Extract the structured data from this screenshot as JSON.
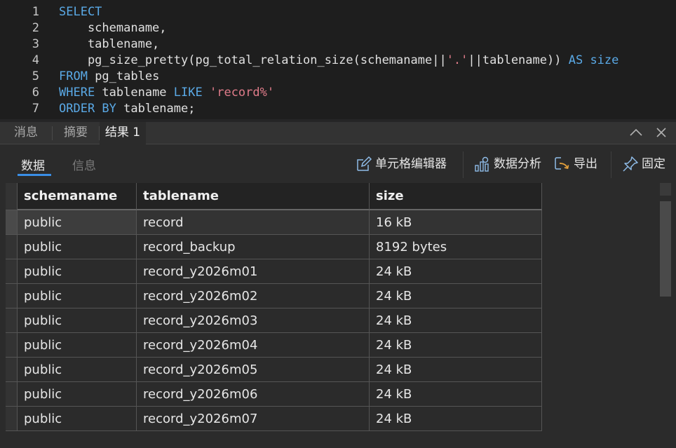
{
  "editor": {
    "lines": [
      {
        "n": "1",
        "tokens": [
          {
            "t": "SELECT",
            "k": "kw"
          }
        ]
      },
      {
        "n": "2",
        "tokens": [
          {
            "t": "    schemaname,",
            "k": "id"
          }
        ]
      },
      {
        "n": "3",
        "tokens": [
          {
            "t": "    tablename,",
            "k": "id"
          }
        ]
      },
      {
        "n": "4",
        "tokens": [
          {
            "t": "    pg_size_pretty(pg_total_relation_size(schemaname||",
            "k": "id"
          },
          {
            "t": "'.'",
            "k": "str"
          },
          {
            "t": "||tablename)) ",
            "k": "id"
          },
          {
            "t": "AS",
            "k": "kw"
          },
          {
            "t": " ",
            "k": "id"
          },
          {
            "t": "size",
            "k": "kw"
          }
        ]
      },
      {
        "n": "5",
        "tokens": [
          {
            "t": "FROM",
            "k": "kw"
          },
          {
            "t": " pg_tables",
            "k": "id"
          }
        ]
      },
      {
        "n": "6",
        "tokens": [
          {
            "t": "WHERE",
            "k": "kw"
          },
          {
            "t": " tablename ",
            "k": "id"
          },
          {
            "t": "LIKE",
            "k": "kw"
          },
          {
            "t": " ",
            "k": "id"
          },
          {
            "t": "'record%'",
            "k": "str"
          }
        ]
      },
      {
        "n": "7",
        "tokens": [
          {
            "t": "ORDER BY",
            "k": "kw"
          },
          {
            "t": " tablename;",
            "k": "id"
          }
        ]
      }
    ]
  },
  "panel_tabs": [
    {
      "label": "消息",
      "active": false
    },
    {
      "label": "摘要",
      "active": false
    },
    {
      "label": "结果 1",
      "active": true
    }
  ],
  "subtabs": {
    "data": "数据",
    "info": "信息"
  },
  "toolbar": {
    "cell_editor": "单元格编辑器",
    "analysis": "数据分析",
    "export": "导出",
    "pin": "固定"
  },
  "grid": {
    "columns": [
      "schemaname",
      "tablename",
      "size"
    ],
    "rows": [
      [
        "public",
        "record",
        "16 kB"
      ],
      [
        "public",
        "record_backup",
        "8192 bytes"
      ],
      [
        "public",
        "record_y2026m01",
        "24 kB"
      ],
      [
        "public",
        "record_y2026m02",
        "24 kB"
      ],
      [
        "public",
        "record_y2026m03",
        "24 kB"
      ],
      [
        "public",
        "record_y2026m04",
        "24 kB"
      ],
      [
        "public",
        "record_y2026m05",
        "24 kB"
      ],
      [
        "public",
        "record_y2026m06",
        "24 kB"
      ],
      [
        "public",
        "record_y2026m07",
        "24 kB"
      ]
    ],
    "selected_row": 0
  },
  "colors": {
    "keyword": "#5aa9e6",
    "string": "#e07c8a",
    "accent": "#3a8ee6"
  }
}
